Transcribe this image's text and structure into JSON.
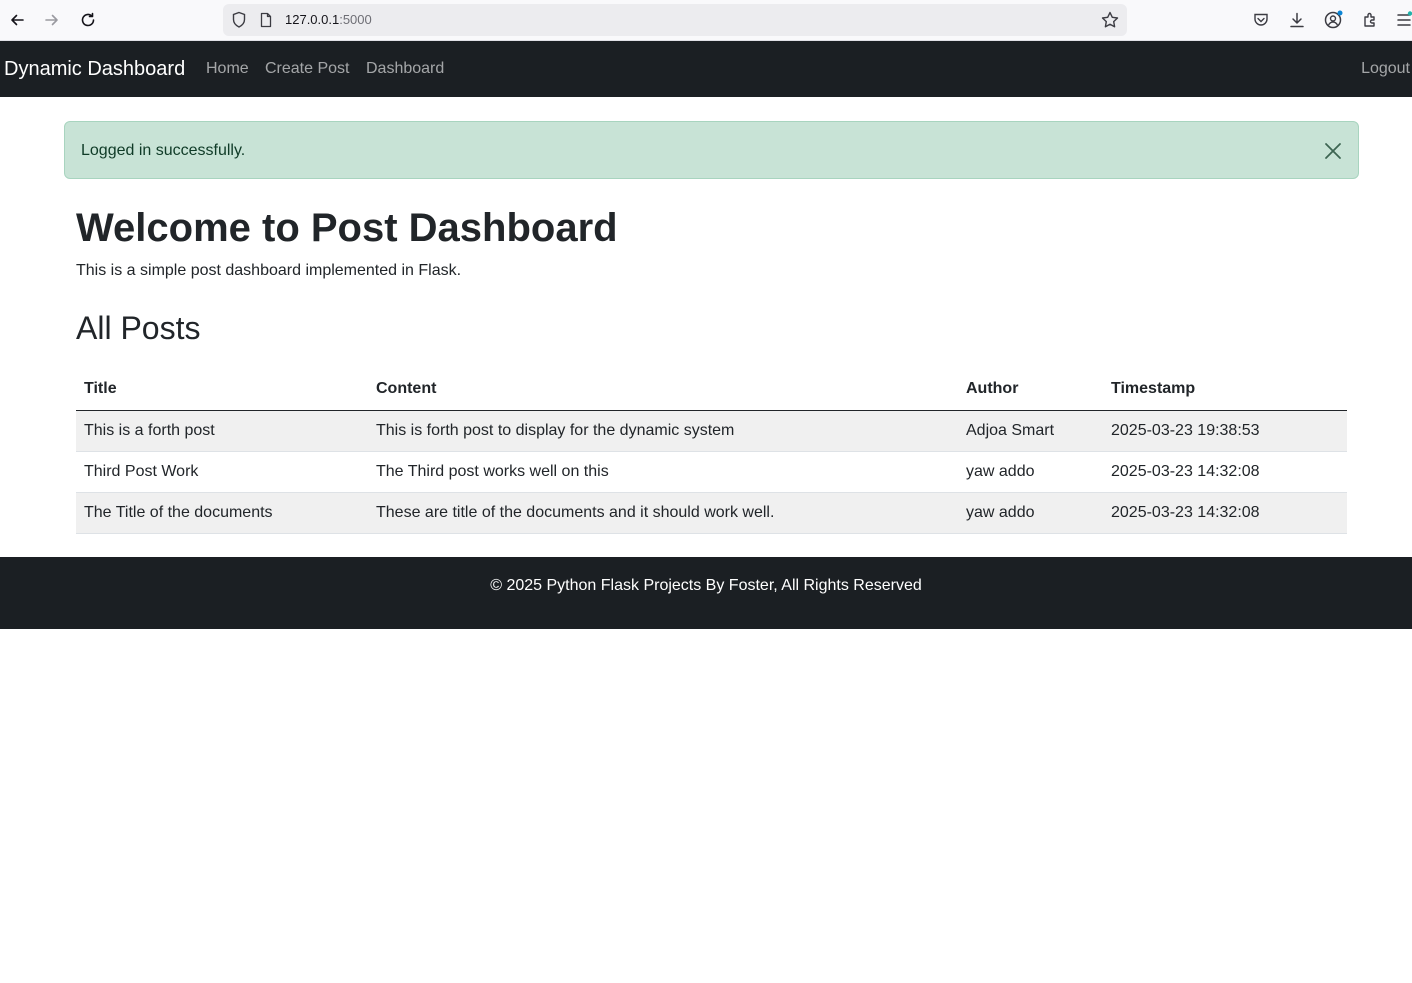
{
  "browser": {
    "url_host": "127.0.0.1",
    "url_port": ":5000",
    "icons": [
      "back-icon",
      "forward-icon",
      "reload-icon",
      "shield-icon",
      "page-icon",
      "bookmark-star-icon",
      "pocket-icon",
      "download-icon",
      "account-icon",
      "extensions-icon",
      "menu-icon"
    ]
  },
  "navbar": {
    "brand": "Dynamic Dashboard",
    "links": [
      "Home",
      "Create Post",
      "Dashboard"
    ],
    "logout": "Logout"
  },
  "alert": {
    "message": "Logged in successfully."
  },
  "main": {
    "title": "Welcome to Post Dashboard",
    "subtitle": "This is a simple post dashboard implemented in Flask.",
    "section_title": "All Posts",
    "table": {
      "headers": [
        "Title",
        "Content",
        "Author",
        "Timestamp"
      ],
      "rows": [
        [
          "This is a forth post",
          "This is forth post to display for the dynamic system",
          "Adjoa Smart",
          "2025-03-23 19:38:53"
        ],
        [
          "Third Post Work",
          "The Third post works well on this",
          "yaw addo",
          "2025-03-23 14:32:08"
        ],
        [
          "The Title of the documents",
          "These are title of the documents and it should work well.",
          "yaw addo",
          "2025-03-23 14:32:08"
        ]
      ]
    }
  },
  "footer": {
    "text": "© 2025 Python Flask Projects By Foster, All Rights Reserved"
  },
  "colors": {
    "navbar_bg": "#1b1f23",
    "alert_bg": "#c8e3d6",
    "alert_text": "#0f3b27",
    "striped_row": "#f0f0f0"
  }
}
